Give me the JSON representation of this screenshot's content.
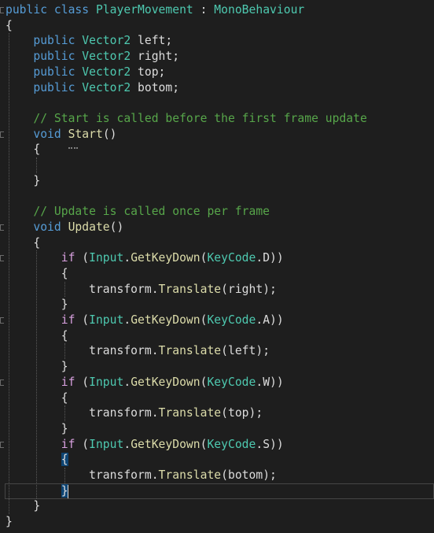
{
  "editor": {
    "lines": [
      {
        "tokens": [
          [
            "kw",
            "public"
          ],
          [
            "plain",
            " "
          ],
          [
            "kw",
            "class"
          ],
          [
            "plain",
            " "
          ],
          [
            "typ",
            "PlayerMovement"
          ],
          [
            "plain",
            " : "
          ],
          [
            "typ",
            "MonoBehaviour"
          ]
        ]
      },
      {
        "tokens": [
          [
            "plain",
            "{"
          ]
        ]
      },
      {
        "tokens": [
          [
            "plain",
            "    "
          ],
          [
            "kw",
            "public"
          ],
          [
            "plain",
            " "
          ],
          [
            "typ",
            "Vector2"
          ],
          [
            "plain",
            " left;"
          ]
        ]
      },
      {
        "tokens": [
          [
            "plain",
            "    "
          ],
          [
            "kw",
            "public"
          ],
          [
            "plain",
            " "
          ],
          [
            "typ",
            "Vector2"
          ],
          [
            "plain",
            " right;"
          ]
        ]
      },
      {
        "tokens": [
          [
            "plain",
            "    "
          ],
          [
            "kw",
            "public"
          ],
          [
            "plain",
            " "
          ],
          [
            "typ",
            "Vector2"
          ],
          [
            "plain",
            " top;"
          ]
        ]
      },
      {
        "tokens": [
          [
            "plain",
            "    "
          ],
          [
            "kw",
            "public"
          ],
          [
            "plain",
            " "
          ],
          [
            "typ",
            "Vector2"
          ],
          [
            "plain",
            " botom;"
          ]
        ]
      },
      {
        "tokens": []
      },
      {
        "tokens": [
          [
            "plain",
            "    "
          ],
          [
            "cmt",
            "// Start is called before the first frame update"
          ]
        ]
      },
      {
        "tokens": [
          [
            "plain",
            "    "
          ],
          [
            "kw",
            "void"
          ],
          [
            "plain",
            " "
          ],
          [
            "fn",
            "Start"
          ],
          [
            "plain",
            "()"
          ]
        ]
      },
      {
        "tokens": [
          [
            "plain",
            "    {"
          ]
        ]
      },
      {
        "tokens": []
      },
      {
        "tokens": [
          [
            "plain",
            "    }"
          ]
        ]
      },
      {
        "tokens": []
      },
      {
        "tokens": [
          [
            "plain",
            "    "
          ],
          [
            "cmt",
            "// Update is called once per frame"
          ]
        ]
      },
      {
        "tokens": [
          [
            "plain",
            "    "
          ],
          [
            "kw",
            "void"
          ],
          [
            "plain",
            " "
          ],
          [
            "fn",
            "Update"
          ],
          [
            "plain",
            "()"
          ]
        ]
      },
      {
        "tokens": [
          [
            "plain",
            "    {"
          ]
        ]
      },
      {
        "tokens": [
          [
            "plain",
            "        "
          ],
          [
            "ctl",
            "if"
          ],
          [
            "plain",
            " ("
          ],
          [
            "typ",
            "Input"
          ],
          [
            "plain",
            "."
          ],
          [
            "fn",
            "GetKeyDown"
          ],
          [
            "plain",
            "("
          ],
          [
            "typ",
            "KeyCode"
          ],
          [
            "plain",
            ".D))"
          ]
        ]
      },
      {
        "tokens": [
          [
            "plain",
            "        {"
          ]
        ]
      },
      {
        "tokens": [
          [
            "plain",
            "            transform."
          ],
          [
            "fn",
            "Translate"
          ],
          [
            "plain",
            "(right);"
          ]
        ]
      },
      {
        "tokens": [
          [
            "plain",
            "        }"
          ]
        ]
      },
      {
        "tokens": [
          [
            "plain",
            "        "
          ],
          [
            "ctl",
            "if"
          ],
          [
            "plain",
            " ("
          ],
          [
            "typ",
            "Input"
          ],
          [
            "plain",
            "."
          ],
          [
            "fn",
            "GetKeyDown"
          ],
          [
            "plain",
            "("
          ],
          [
            "typ",
            "KeyCode"
          ],
          [
            "plain",
            ".A))"
          ]
        ]
      },
      {
        "tokens": [
          [
            "plain",
            "        {"
          ]
        ]
      },
      {
        "tokens": [
          [
            "plain",
            "            transform."
          ],
          [
            "fn",
            "Translate"
          ],
          [
            "plain",
            "(left);"
          ]
        ]
      },
      {
        "tokens": [
          [
            "plain",
            "        }"
          ]
        ]
      },
      {
        "tokens": [
          [
            "plain",
            "        "
          ],
          [
            "ctl",
            "if"
          ],
          [
            "plain",
            " ("
          ],
          [
            "typ",
            "Input"
          ],
          [
            "plain",
            "."
          ],
          [
            "fn",
            "GetKeyDown"
          ],
          [
            "plain",
            "("
          ],
          [
            "typ",
            "KeyCode"
          ],
          [
            "plain",
            ".W))"
          ]
        ]
      },
      {
        "tokens": [
          [
            "plain",
            "        {"
          ]
        ]
      },
      {
        "tokens": [
          [
            "plain",
            "            transform."
          ],
          [
            "fn",
            "Translate"
          ],
          [
            "plain",
            "(top);"
          ]
        ]
      },
      {
        "tokens": [
          [
            "plain",
            "        }"
          ]
        ]
      },
      {
        "tokens": [
          [
            "plain",
            "        "
          ],
          [
            "ctl",
            "if"
          ],
          [
            "plain",
            " ("
          ],
          [
            "typ",
            "Input"
          ],
          [
            "plain",
            "."
          ],
          [
            "fn",
            "GetKeyDown"
          ],
          [
            "plain",
            "("
          ],
          [
            "typ",
            "KeyCode"
          ],
          [
            "plain",
            ".S))"
          ]
        ]
      },
      {
        "tokens": [
          [
            "plain",
            "        "
          ],
          [
            "plain",
            "{",
            "brace"
          ]
        ]
      },
      {
        "tokens": [
          [
            "plain",
            "            transform."
          ],
          [
            "fn",
            "Translate"
          ],
          [
            "plain",
            "(botom);"
          ]
        ]
      },
      {
        "tokens": [
          [
            "plain",
            "        "
          ],
          [
            "plain",
            "}",
            "brace"
          ]
        ]
      },
      {
        "tokens": [
          [
            "plain",
            "    }"
          ]
        ]
      },
      {
        "tokens": [
          [
            "plain",
            "}"
          ]
        ]
      }
    ],
    "fold_lines": [
      0,
      8,
      14,
      16,
      20,
      24,
      28
    ],
    "colors": {
      "background": "#1e1e1e",
      "keyword": "#569cd6",
      "control": "#d8a0df",
      "type": "#4ec9b0",
      "method": "#dcdcaa",
      "comment": "#57a64a",
      "text": "#dcdcdc",
      "brace_highlight": "#0e4574"
    }
  }
}
